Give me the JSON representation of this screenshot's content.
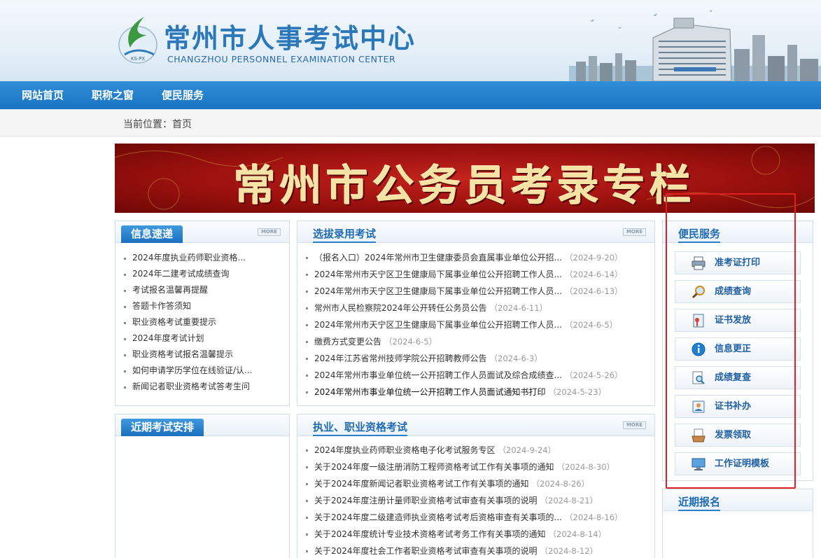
{
  "header": {
    "title": "常州市人事考试中心",
    "subtitle": "CHANGZHOU PERSONNEL EXAMINATION CENTER",
    "emblem_text": "KS·PX"
  },
  "nav": {
    "items": [
      "网站首页",
      "职称之窗",
      "便民服务"
    ]
  },
  "breadcrumb": {
    "prefix": "当前位置：",
    "current": "首页"
  },
  "banner": {
    "text": "常州市公务员考录专栏"
  },
  "more_label": "MORE",
  "news": {
    "title": "信息速递",
    "items": [
      "2024年度执业药师职业资格...",
      "2024年二建考试成绩查询",
      "考试报名温馨再提醒",
      "答题卡作答须知",
      "职业资格考试重要提示",
      "2024年度考试计划",
      "职业资格考试报名温馨提示",
      "如何申请学历学位在线验证/认...",
      "新闻记者职业资格考试答考生问"
    ]
  },
  "schedule": {
    "title": "近期考试安排"
  },
  "selection": {
    "title": "选拔录用考试",
    "items": [
      {
        "text": "（报名入口）2024年常州市卫生健康委员会直属事业单位公开招...",
        "date": "（2024-9-20）"
      },
      {
        "text": "2024年常州市天宁区卫生健康局下属事业单位公开招聘工作人员...",
        "date": "（2024-6-14）"
      },
      {
        "text": "2024年常州市天宁区卫生健康局下属事业单位公开招聘工作人员...",
        "date": "（2024-6-13）"
      },
      {
        "text": "常州市人民检察院2024年公开转任公务员公告",
        "date": "（2024-6-11）"
      },
      {
        "text": "2024年常州市天宁区卫生健康局下属事业单位公开招聘工作人员...",
        "date": "（2024-6-5）"
      },
      {
        "text": "缴费方式变更公告",
        "date": "（2024-6-5）"
      },
      {
        "text": "2024年江苏省常州技师学院公开招聘教师公告",
        "date": "（2024-6-3）"
      },
      {
        "text": "2024年常州市事业单位统一公开招聘工作人员面试及综合成绩查...",
        "date": "（2024-5-26）"
      },
      {
        "text": "2024年常州市事业单位统一公开招聘工作人员面试通知书打印",
        "date": "（2024-5-23）"
      }
    ]
  },
  "qualification": {
    "title": "执业、职业资格考试",
    "items": [
      {
        "text": "2024年度执业药师职业资格电子化考试服务专区",
        "date": "（2024-9-24）"
      },
      {
        "text": "关于2024年度一级注册消防工程师资格考试工作有关事项的通知",
        "date": "（2024-8-30）"
      },
      {
        "text": "关于2024年度新闻记者职业资格考试工作有关事项的通知",
        "date": "（2024-8-26）"
      },
      {
        "text": "关于2024年度注册计量师职业资格考试审查有关事项的说明",
        "date": "（2024-8-21）"
      },
      {
        "text": "关于2024年度二级建造师执业资格考试考后资格审查有关事项的...",
        "date": "（2024-8-16）"
      },
      {
        "text": "关于2024年度统计专业技术资格考试考务工作有关事项的通知",
        "date": "（2024-8-14）"
      },
      {
        "text": "关于2024年度社会工作者职业资格考试审查有关事项的说明",
        "date": "（2024-8-12）"
      }
    ]
  },
  "services": {
    "title": "便民服务",
    "items": [
      {
        "label": "准考证打印",
        "icon": "printer-icon"
      },
      {
        "label": "成绩查询",
        "icon": "magnifier-icon"
      },
      {
        "label": "证书发放",
        "icon": "certificate-icon"
      },
      {
        "label": "信息更正",
        "icon": "info-icon"
      },
      {
        "label": "成绩复查",
        "icon": "document-search-icon"
      },
      {
        "label": "证书补办",
        "icon": "id-card-icon"
      },
      {
        "label": "发票领取",
        "icon": "invoice-tray-icon"
      },
      {
        "label": "工作证明模板",
        "icon": "monitor-icon"
      }
    ]
  },
  "recent_registration": {
    "title": "近期报名"
  },
  "colors": {
    "nav_blue": "#1a73c2",
    "link_blue": "#1f5fa4",
    "banner_red": "#9c110e",
    "highlight_red": "#e02020"
  }
}
